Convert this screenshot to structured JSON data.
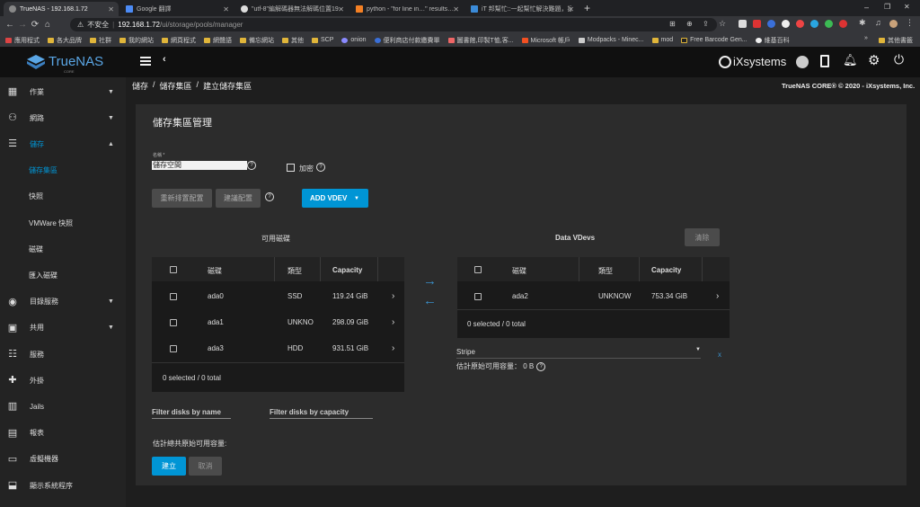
{
  "browser": {
    "tabs": [
      {
        "title": "TrueNAS - 192.168.1.72",
        "favcolor": "#888888"
      },
      {
        "title": "Google 翻譯",
        "favcolor": "#4c8bf5"
      },
      {
        "title": "\"utf-8\"編解碼器無法解碼位置19…",
        "favcolor": "#dddddd"
      },
      {
        "title": "python - \"for line in…\" results…",
        "favcolor": "#f48024"
      },
      {
        "title": "iT 邦幫忙::一起幫忙解決難題，拯…",
        "favcolor": "#3b8bd8"
      }
    ],
    "new_tab": "+",
    "address": {
      "security": "不安全",
      "host": "192.168.1.72",
      "path": "/ui/storage/pools/manager"
    },
    "bookmarks": [
      "應用程式",
      "各大品牌",
      "社群",
      "我的網站",
      "網頁程式",
      "網聲語",
      "備忘網站",
      "其他",
      "SCP",
      "onion",
      "便利商店付款繳費單",
      "圖書館,印製T恤,客...",
      "Microsoft 帳戶",
      "Modpacks - Minec...",
      "mod",
      "Free Barcode Gen...",
      "維基百科"
    ],
    "bookmarks_more": "»",
    "other_bookmarks": "其他書籤"
  },
  "app": {
    "logo": "TrueNAS",
    "logo_sub": "CORE",
    "vendor": "iXsystems",
    "version": "TrueNAS CORE® © 2020 - iXsystems, Inc."
  },
  "sidebar": [
    {
      "label": "作業",
      "icon": "calendar-icon",
      "chevron": "▼"
    },
    {
      "label": "網路",
      "icon": "network-icon",
      "chevron": "▼"
    },
    {
      "label": "儲存",
      "icon": "storage-icon",
      "chevron": "▲",
      "active": true
    },
    {
      "label": "儲存集區",
      "sub": true,
      "active": true
    },
    {
      "label": "快照",
      "sub": true
    },
    {
      "label": "VMWare 快照",
      "sub": true
    },
    {
      "label": "磁碟",
      "sub": true
    },
    {
      "label": "匯入磁碟",
      "sub": true
    },
    {
      "label": "目錄服務",
      "icon": "directory-icon",
      "chevron": "▼"
    },
    {
      "label": "共用",
      "icon": "share-icon",
      "chevron": "▼"
    },
    {
      "label": "服務",
      "icon": "services-icon"
    },
    {
      "label": "外掛",
      "icon": "plugin-icon"
    },
    {
      "label": "Jails",
      "icon": "jails-icon"
    },
    {
      "label": "報表",
      "icon": "reports-icon"
    },
    {
      "label": "虛擬機器",
      "icon": "vm-icon"
    },
    {
      "label": "顯示系統程序",
      "icon": "process-icon"
    }
  ],
  "breadcrumb": [
    "儲存",
    "儲存集區",
    "建立儲存集區"
  ],
  "breadcrumb_sep": "/",
  "manager": {
    "title": "儲存集區管理",
    "name_label": "名稱 *",
    "name_value": "儲存空間",
    "help": "?",
    "encryption_label": "加密",
    "reset_layout": "重新排置配置",
    "suggest_layout": "建議配置",
    "add_vdev": "ADD VDEV",
    "add_vdev_caret": "▼",
    "available_title": "可用磁碟",
    "vdevs_title": "Data VDevs",
    "remove": "清除",
    "col_disk": "磁碟",
    "col_type": "類型",
    "col_capacity": "Capacity",
    "row_chevron": "›",
    "available_disks": [
      {
        "name": "ada0",
        "type": "SSD",
        "capacity": "119.24 GiB"
      },
      {
        "name": "ada1",
        "type": "UNKNO",
        "capacity": "298.09 GiB"
      },
      {
        "name": "ada3",
        "type": "HDD",
        "capacity": "931.51 GiB"
      }
    ],
    "available_footer": "0 selected / 0 total",
    "vdev_disks": [
      {
        "name": "ada2",
        "type": "UNKNOW",
        "capacity": "753.34 GiB"
      }
    ],
    "vdev_footer": "0 selected / 0 total",
    "vdev_layout": "Stripe",
    "vdev_layout_caret": "▼",
    "vdev_close": "x",
    "vdev_estimate": "估計原始可用容量： 0 B",
    "arrow_right": "→",
    "arrow_left": "←",
    "filter_name": "Filter disks by name",
    "filter_capacity": "Filter disks by capacity",
    "total_estimate": "估計總共原始可用容量:",
    "create": "建立",
    "cancel": "取消"
  },
  "colors": {
    "accent": "#0095d5",
    "logo": "#5aa6e5"
  }
}
